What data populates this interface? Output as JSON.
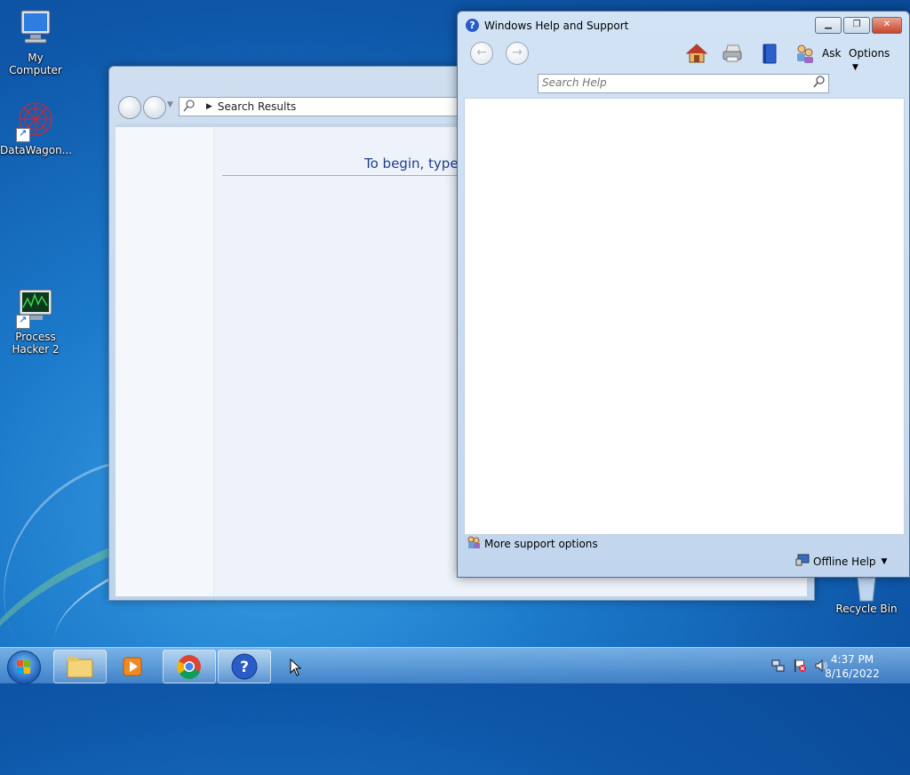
{
  "desktop": {
    "icons": [
      {
        "label": "My Computer"
      },
      {
        "label": "DataWagon..."
      },
      {
        "label": "Process Hacker 2"
      },
      {
        "label": "Recycle Bin"
      }
    ]
  },
  "search_window": {
    "address": "Search Results",
    "prompt": "To begin, type i"
  },
  "help_window": {
    "title": "Windows Help and Support",
    "toolbar": {
      "ask_label": "Ask",
      "options_label": "Options"
    },
    "search": {
      "placeholder": "Search Help"
    },
    "more_support": "More support options",
    "offline_help": "Offline Help"
  },
  "taskbar": {
    "clock_time": "4:37 PM",
    "clock_date": "8/16/2022"
  }
}
